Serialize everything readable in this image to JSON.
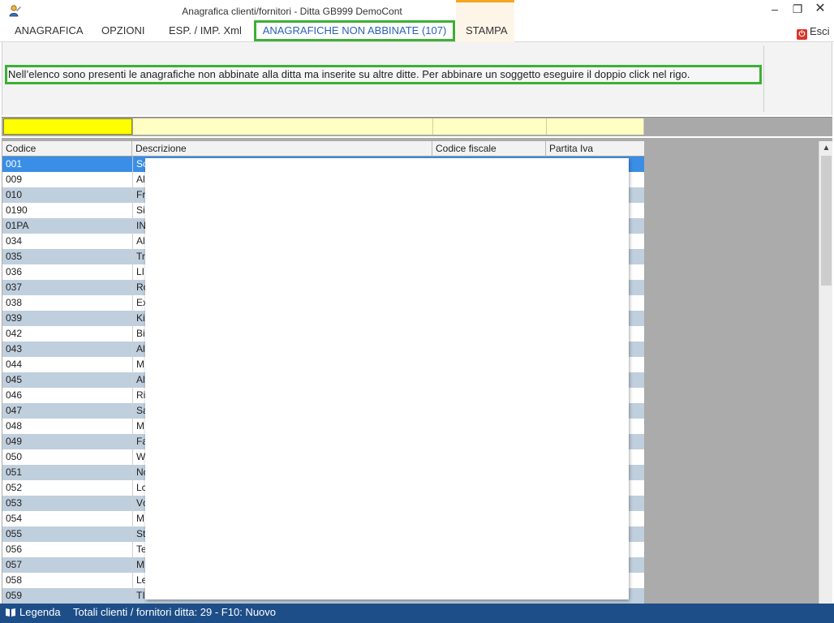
{
  "window": {
    "title": "Anagrafica clienti/fornitori - Ditta GB999 DemoCont",
    "minimize": "–",
    "maximize": "❐",
    "close": "✕"
  },
  "tabs": [
    {
      "label": "ANAGRAFICA"
    },
    {
      "label": "OPZIONI"
    },
    {
      "label": "ESP. / IMP. Xml"
    },
    {
      "label": "ANAGRAFICHE NON ABBINATE (107)"
    },
    {
      "label": "STAMPA"
    }
  ],
  "exit_label": "Esci",
  "info_message": "Nell’elenco sono presenti le anagrafiche non abbinate alla ditta ma inserite su altre ditte. Per abbinare un soggetto eseguire il doppio click nel rigo.",
  "grid": {
    "columns": [
      "Codice",
      "Descrizione",
      "Codice fiscale",
      "Partita Iva"
    ],
    "rows": [
      {
        "codice": "001",
        "desc": "Sc"
      },
      {
        "codice": "009",
        "desc": "Al"
      },
      {
        "codice": "010",
        "desc": "Fr"
      },
      {
        "codice": "0190",
        "desc": "Si"
      },
      {
        "codice": "01PA",
        "desc": "IN"
      },
      {
        "codice": "034",
        "desc": "Al"
      },
      {
        "codice": "035",
        "desc": "Tr"
      },
      {
        "codice": "036",
        "desc": "LI"
      },
      {
        "codice": "037",
        "desc": "Rc"
      },
      {
        "codice": "038",
        "desc": "Ex"
      },
      {
        "codice": "039",
        "desc": "Ki"
      },
      {
        "codice": "042",
        "desc": "Bi"
      },
      {
        "codice": "043",
        "desc": "Al"
      },
      {
        "codice": "044",
        "desc": "M"
      },
      {
        "codice": "045",
        "desc": "Al"
      },
      {
        "codice": "046",
        "desc": "Ri"
      },
      {
        "codice": "047",
        "desc": "Sa"
      },
      {
        "codice": "048",
        "desc": "M"
      },
      {
        "codice": "049",
        "desc": "Fa"
      },
      {
        "codice": "050",
        "desc": "W"
      },
      {
        "codice": "051",
        "desc": "Nc"
      },
      {
        "codice": "052",
        "desc": "Lc"
      },
      {
        "codice": "053",
        "desc": "Vc"
      },
      {
        "codice": "054",
        "desc": "M"
      },
      {
        "codice": "055",
        "desc": "St"
      },
      {
        "codice": "056",
        "desc": "Te"
      },
      {
        "codice": "057",
        "desc": "M"
      },
      {
        "codice": "058",
        "desc": "Le"
      },
      {
        "codice": "059",
        "desc": "TI"
      }
    ]
  },
  "statusbar": {
    "legenda": "Legenda",
    "totali": "Totali clienti / fornitori ditta: 29  -  F10: Nuovo"
  },
  "colors": {
    "highlight_border": "#3db035",
    "statusbar_bg": "#1d4e88",
    "selected_row": "#3a8ee6",
    "alt_row": "#c0cfdd",
    "filter_bg": "#ffffc4"
  }
}
